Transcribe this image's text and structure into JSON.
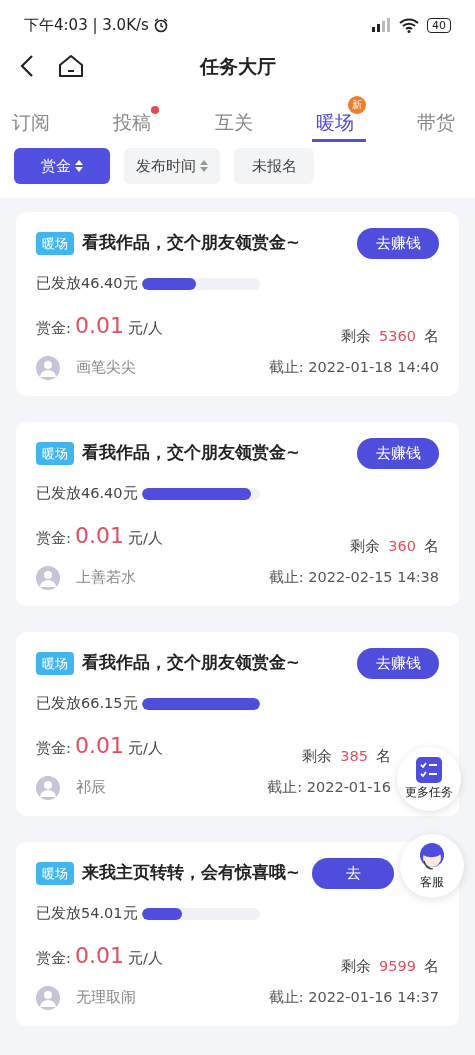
{
  "status_bar": {
    "time": "下午4:03 | 3.0K/s",
    "battery": "40"
  },
  "header": {
    "title": "任务大厅"
  },
  "tabs": [
    {
      "label": "订阅",
      "selected": false
    },
    {
      "label": "投稿",
      "selected": false,
      "badge": {
        "kind": "dot"
      }
    },
    {
      "label": "互关",
      "selected": false
    },
    {
      "label": "暖场",
      "selected": true,
      "badge": {
        "kind": "text",
        "text": "新"
      }
    },
    {
      "label": "带货",
      "selected": false
    }
  ],
  "filters": [
    {
      "label": "赏金",
      "selected": true,
      "sortable": true
    },
    {
      "label": "发布时间",
      "selected": false,
      "sortable": true
    },
    {
      "label": "未报名",
      "selected": false,
      "sortable": false
    }
  ],
  "tasks": [
    {
      "tag": "暖场",
      "title": "看我作品，交个朋友领赏金~",
      "button": "去赚钱",
      "paid": "已发放46.40元",
      "level": 0.46,
      "reward_label": "赏金:",
      "reward_amount": "0.01",
      "reward_unit": "元/人",
      "remaining_label": "剩余",
      "remaining": "5360",
      "remaining_unit": "名",
      "author": "画笔尖尖",
      "deadline": "截止: 2022-01-18 14:40"
    },
    {
      "tag": "暖场",
      "title": "看我作品，交个朋友领赏金~",
      "button": "去赚钱",
      "paid": "已发放46.40元",
      "level": 0.93,
      "reward_label": "赏金:",
      "reward_amount": "0.01",
      "reward_unit": "元/人",
      "remaining_label": "剩余",
      "remaining": "360",
      "remaining_unit": "名",
      "author": "上善若水",
      "deadline": "截止: 2022-02-15 14:38"
    },
    {
      "tag": "暖场",
      "title": "看我作品，交个朋友领赏金~",
      "button": "去赚钱",
      "paid": "已发放66.15元",
      "level": 1,
      "reward_label": "赏金:",
      "reward_amount": "0.01",
      "reward_unit": "元/人",
      "remaining_label": "剩余",
      "remaining": "385",
      "remaining_unit": "名",
      "author": "祁辰",
      "deadline": "截止: 2022-01-16"
    },
    {
      "tag": "暖场",
      "title": "来我主页转转，会有惊喜哦~",
      "button": "去",
      "paid": "已发放54.01元",
      "level": 0.34,
      "reward_label": "赏金:",
      "reward_amount": "0.01",
      "reward_unit": "元/人",
      "remaining_label": "剩余",
      "remaining": "9599",
      "remaining_unit": "名",
      "author": "无理取闹",
      "deadline": "截止: 2022-01-16 14:37"
    }
  ],
  "floating": [
    {
      "kind": "tasks",
      "label": "更多任务"
    },
    {
      "kind": "service",
      "label": "客服"
    }
  ]
}
